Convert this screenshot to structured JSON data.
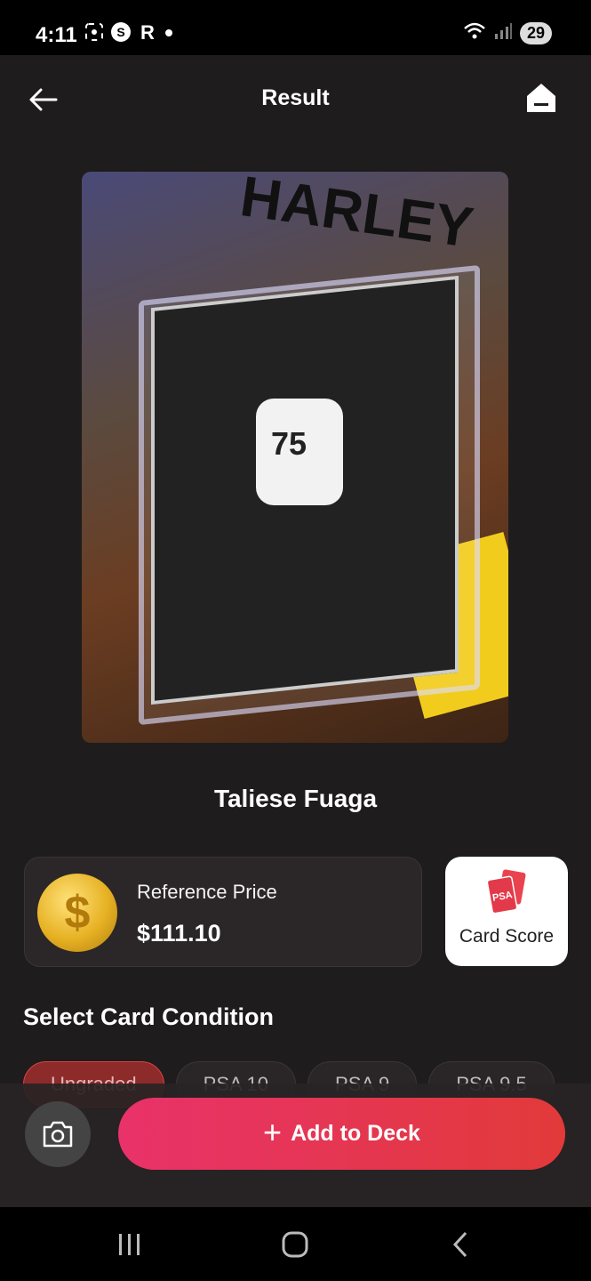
{
  "status_bar": {
    "time": "4:11",
    "battery": "29"
  },
  "header": {
    "title": "Result"
  },
  "card": {
    "jersey_number": "75",
    "brand_text": "HARLEY"
  },
  "player": {
    "name": "Taliese Fuaga"
  },
  "price": {
    "label": "Reference Price",
    "value": "$111.10",
    "coin_symbol": "$"
  },
  "score": {
    "label": "Card Score",
    "badge": "PSA"
  },
  "condition": {
    "title": "Select Card Condition",
    "options": [
      "Ungraded",
      "PSA 10",
      "PSA 9",
      "PSA 9.5"
    ],
    "selected": "Ungraded"
  },
  "actions": {
    "add_label": "Add to Deck",
    "add_icon": "plus-icon",
    "camera_icon": "camera-icon"
  },
  "colors": {
    "accent_start": "#e8326a",
    "accent_end": "#e23a3a",
    "background": "#1f1c1d"
  }
}
